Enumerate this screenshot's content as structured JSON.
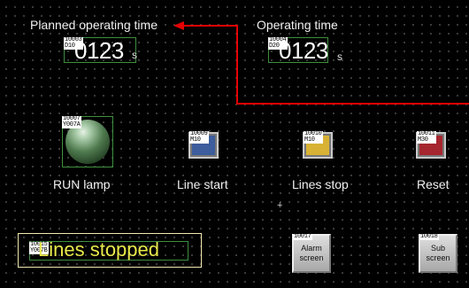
{
  "planned": {
    "label": "Planned operating time",
    "tag_top": "10003",
    "tag_bot": "D10",
    "value": "0123",
    "unit": "s"
  },
  "operating": {
    "label": "Operating time",
    "tag_top": "10004",
    "tag_bot": "D20",
    "value": "0123",
    "unit": "s"
  },
  "run_lamp": {
    "label": "RUN lamp",
    "tag_top": "10007",
    "tag_bot": "Y007A"
  },
  "line_start": {
    "label": "Line start",
    "tag_top": "10009",
    "tag_bot": "M10",
    "color": "#3d5d9c"
  },
  "lines_stop": {
    "label": "Lines stop",
    "tag_top": "10010",
    "tag_bot": "M10",
    "color": "#d8b234"
  },
  "reset": {
    "label": "Reset",
    "tag_top": "10011",
    "tag_bot": "M30",
    "color": "#a5262e"
  },
  "message": {
    "text": "Lines stopped",
    "tag_top": "10015",
    "tag_bot": "Y007B",
    "color": "#e8e84a"
  },
  "alarm_screen": {
    "tag_top": "10017",
    "line1": "Alarm",
    "line2": "screen"
  },
  "sub_screen": {
    "tag_top": "10018",
    "line1": "Sub",
    "line2": "screen"
  },
  "arrow_color": "#e60000"
}
